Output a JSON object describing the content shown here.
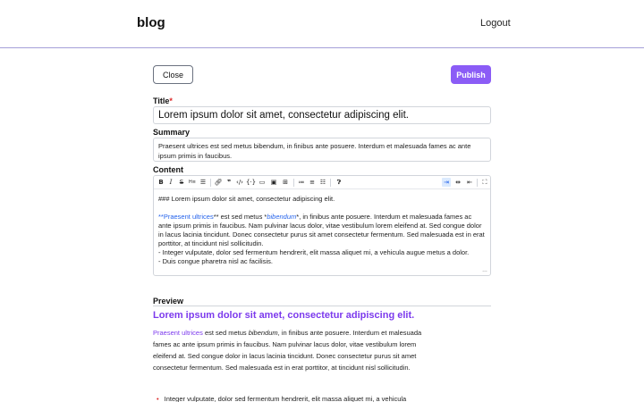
{
  "header": {
    "brand": "blog",
    "logout_label": "Logout"
  },
  "actions": {
    "close_label": "Close",
    "publish_label": "Publish",
    "publish_color": "#8b5cf6"
  },
  "form": {
    "title_label": "Title",
    "required_mark": "*",
    "title_value": "Lorem ipsum dolor sit amet, consectetur adipiscing elit.",
    "summary_label": "Summary",
    "summary_value": "Praesent ultrices est sed metus bibendum, in finibus ante posuere. Interdum et malesuada fames ac ante ipsum primis in faucibus.",
    "content_label": "Content"
  },
  "toolbar": {
    "bold": "B",
    "italic": "I",
    "strike": "S",
    "heading": "H",
    "icons": [
      "bold-icon",
      "italic-icon",
      "strikethrough-icon",
      "heading-icon",
      "hr-icon",
      "link-icon",
      "quote-icon",
      "code-icon",
      "code-block-icon",
      "comment-icon",
      "image-icon",
      "table-icon",
      "unordered-list-icon",
      "ordered-list-icon",
      "checklist-icon",
      "help-icon",
      "split-view-icon",
      "preview-icon",
      "edit-only-icon",
      "fullscreen-icon"
    ]
  },
  "editor": {
    "line1": "### Lorem ipsum dolor sit amet, consectetur adipiscing elit.",
    "para_prefix": "**",
    "para_link": "Praesent ultrices",
    "para_mid1": "** est sed metus *",
    "para_em": "bibendum",
    "para_rest": "*, in finibus ante posuere. Interdum et malesuada fames ac ante ipsum primis in faucibus. Nam pulvinar lacus dolor, vitae vestibulum lorem eleifend at. Sed congue dolor in lacus lacinia tincidunt. Donec consectetur purus sit amet consectetur fermentum. Sed malesuada est in erat porttitor, at tincidunt nisl sollicitudin.",
    "list1": "- Integer vulputate, dolor sed fermentum hendrerit, elit massa aliquet mi, a vehicula augue metus a dolor.",
    "list2": "- Duis congue pharetra nisl ac facilisis."
  },
  "preview": {
    "label": "Preview",
    "title": "Lorem ipsum dolor sit amet, consectetur adipiscing elit.",
    "para_link": "Praesent ultrices",
    "para_mid": " est sed metus ",
    "para_em": "bibendum",
    "para_rest": ", in finibus ante posuere. Interdum et malesuada fames ac ante ipsum primis in faucibus. Nam pulvinar lacus dolor, vitae vestibulum lorem eleifend at. Sed congue dolor in lacus lacinia tincidunt. Donec consectetur purus sit amet consectetur fermentum. Sed malesuada est in erat porttitor, at tincidunt nisl sollicitudin.",
    "list1": "Integer vulputate, dolor sed fermentum hendrerit, elit massa aliquet mi, a vehicula"
  }
}
